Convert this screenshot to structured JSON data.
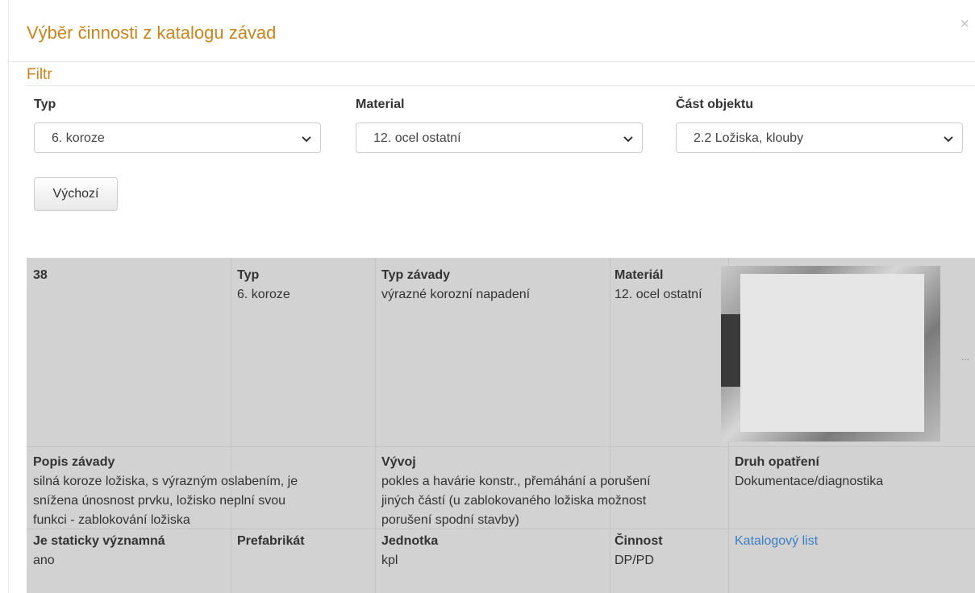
{
  "modal": {
    "title": "Výběr činnosti z katalogu závad",
    "close_label": "×"
  },
  "filter": {
    "title": "Filtr",
    "typ": {
      "label": "Typ",
      "value": "6. koroze"
    },
    "material": {
      "label": "Material",
      "value": "12. ocel ostatní"
    },
    "cast": {
      "label": "Část objektu",
      "value": "2.2 Ložiska, klouby"
    },
    "default_button": "Výchozí"
  },
  "record": {
    "id": "38",
    "typ": {
      "label": "Typ",
      "value": "6. koroze"
    },
    "typ_zavady": {
      "label": "Typ závady",
      "value": "výrazné korozní napadení"
    },
    "material": {
      "label": "Materiál",
      "value": "12. ocel ostatní"
    },
    "photo_more": "...",
    "popis": {
      "label": "Popis závady",
      "lines": [
        "silná koroze ložiska, s výrazným oslabením, je",
        "snížena únosnost prvku, ložisko neplní svou",
        "funkci - zablokování ložiska"
      ]
    },
    "vyvoj": {
      "label": "Vývoj",
      "lines": [
        "pokles a havárie konstr., přemáhání a porušení",
        "jiných částí (u zablokovaného ložiska možnost",
        "porušení spodní stavby)"
      ]
    },
    "druh": {
      "label": "Druh opatření",
      "value": "Dokumentace/diagnostika"
    },
    "staticky": {
      "label": "Je staticky významná",
      "value": "ano"
    },
    "prefabrikat": {
      "label": "Prefabrikát"
    },
    "jednotka": {
      "label": "Jednotka",
      "value": "kpl"
    },
    "cinnost": {
      "label": "Činnost",
      "value": "DP/PD"
    },
    "katalog_link": "Katalogový list"
  }
}
